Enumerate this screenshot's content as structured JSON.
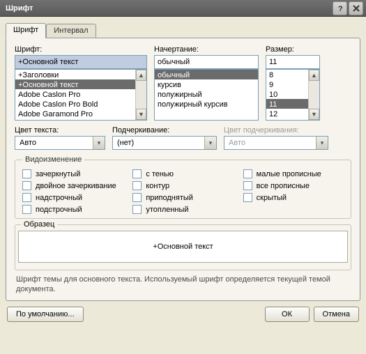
{
  "window": {
    "title": "Шрифт"
  },
  "tabs": {
    "font": "Шрифт",
    "spacing": "Интервал"
  },
  "labels": {
    "font": "Шрифт:",
    "style": "Начертание:",
    "size": "Размер:",
    "text_color": "Цвет текста:",
    "underline": "Подчеркивание:",
    "underline_color": "Цвет подчеркивания:"
  },
  "font": {
    "value": "+Основной текст",
    "items": [
      "+Заголовки",
      "+Основной текст",
      "Adobe Caslon Pro",
      "Adobe Caslon Pro Bold",
      "Adobe Garamond Pro"
    ],
    "selected_index": 1
  },
  "style": {
    "value": "обычный",
    "items": [
      "обычный",
      "курсив",
      "полужирный",
      "полужирный курсив"
    ],
    "selected_index": 0
  },
  "size": {
    "value": "11",
    "items": [
      "8",
      "9",
      "10",
      "11",
      "12"
    ],
    "selected_index": 3
  },
  "text_color": {
    "value": "Авто"
  },
  "underline_style": {
    "value": "(нет)"
  },
  "underline_color": {
    "value": "Авто"
  },
  "effects": {
    "legend": "Видоизменение",
    "strike": "зачеркнутый",
    "dstrike": "двойное зачеркивание",
    "superscript": "надстрочный",
    "subscript": "подстрочный",
    "shadow": "с тенью",
    "outline": "контур",
    "emboss": "приподнятый",
    "engrave": "утопленный",
    "smallcaps": "малые прописные",
    "allcaps": "все прописные",
    "hidden": "скрытый"
  },
  "sample": {
    "label": "Образец",
    "text": "+Основной текст"
  },
  "hint": "Шрифт темы для основного текста. Используемый шрифт определяется текущей темой документа.",
  "buttons": {
    "default": "По умолчанию...",
    "ok": "ОК",
    "cancel": "Отмена"
  }
}
